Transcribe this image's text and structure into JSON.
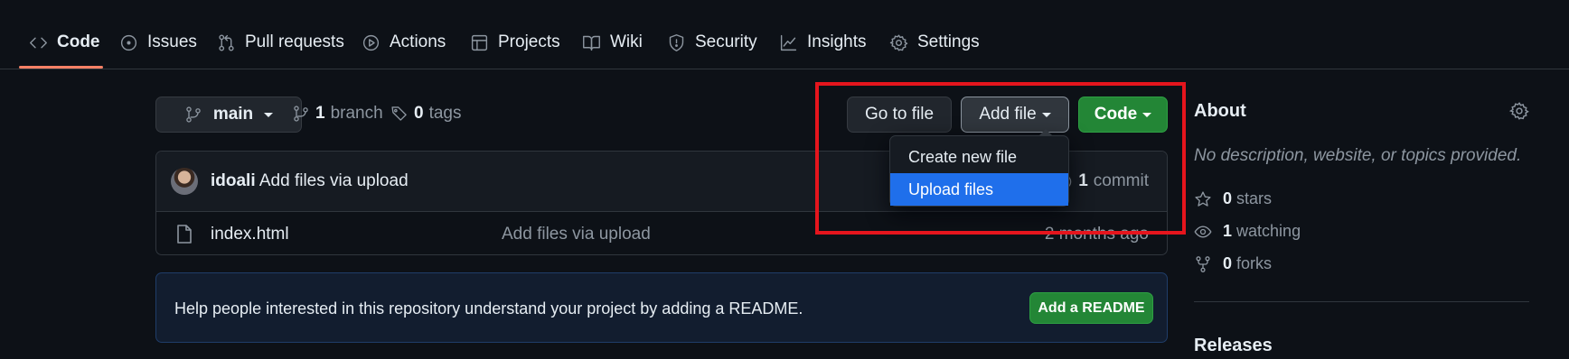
{
  "tabs": [
    {
      "label": "Code",
      "icon": "code-icon",
      "active": true
    },
    {
      "label": "Issues",
      "icon": "issue-circle-icon"
    },
    {
      "label": "Pull requests",
      "icon": "pull-request-icon"
    },
    {
      "label": "Actions",
      "icon": "play-icon"
    },
    {
      "label": "Projects",
      "icon": "table-icon"
    },
    {
      "label": "Wiki",
      "icon": "book-icon"
    },
    {
      "label": "Security",
      "icon": "shield-icon"
    },
    {
      "label": "Insights",
      "icon": "graph-icon"
    },
    {
      "label": "Settings",
      "icon": "gear-icon"
    }
  ],
  "toolbar": {
    "branch": "main",
    "branch_count": "1",
    "branch_label": "branch",
    "tag_count": "0",
    "tag_label": "tags",
    "go_to_file": "Go to file",
    "add_file": "Add file",
    "code": "Code"
  },
  "dropdown": {
    "items": [
      {
        "label": "Create new file"
      },
      {
        "label": "Upload files",
        "selected": true
      }
    ]
  },
  "commit": {
    "author": "idoali",
    "message": "Add files via upload",
    "count": "1",
    "count_label": "commit"
  },
  "files": [
    {
      "name": "index.html",
      "message": "Add files via upload",
      "age": "2 months ago"
    }
  ],
  "readme": {
    "text": "Help people interested in this repository understand your project by adding a README.",
    "button": "Add a README"
  },
  "about": {
    "title": "About",
    "description": "No description, website, or topics provided.",
    "stars_count": "0",
    "stars_label": "stars",
    "watching_count": "1",
    "watching_label": "watching",
    "forks_count": "0",
    "forks_label": "forks"
  },
  "releases": {
    "title": "Releases"
  },
  "colors": {
    "background": "#0d1117",
    "accent_underline": "#f78166",
    "green_button": "#238636",
    "selected_item": "#1f6feb",
    "highlight_box": "#e5151d"
  }
}
